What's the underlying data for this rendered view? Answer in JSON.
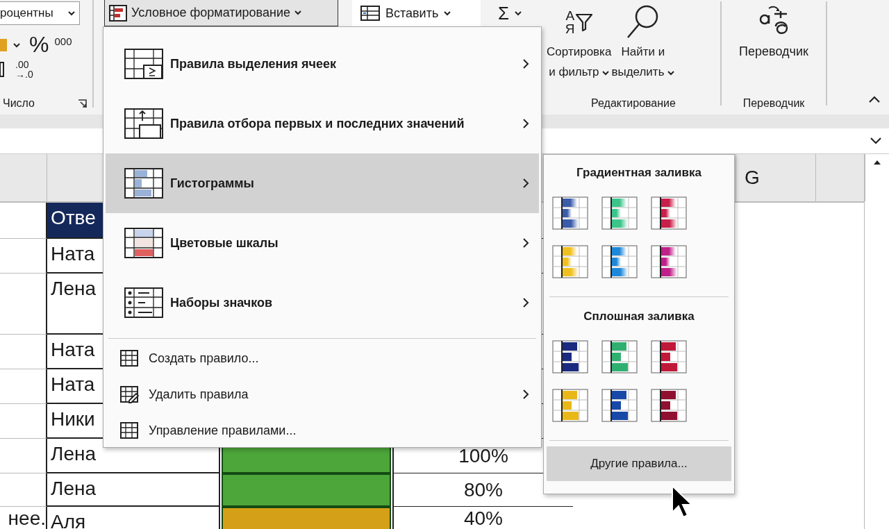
{
  "ribbon": {
    "number_format": {
      "value": "роцентны"
    },
    "percent_symbol": "%",
    "thousands_symbol": "000",
    "decimal_texts": [
      ".00",
      "→.0"
    ],
    "number_group_label": "Число",
    "conditional_formatting": {
      "label": "Условное форматирование",
      "expanded": true
    },
    "insert": {
      "label": "Вставить"
    },
    "sum_symbol": "Σ",
    "sort": {
      "icon_letters": [
        "А",
        "Я"
      ],
      "lines": [
        "Сортировка",
        "и фильтр"
      ]
    },
    "find": {
      "lines": [
        "Найти и",
        "выделить"
      ]
    },
    "editing_group_label": "Редактирование",
    "translator": {
      "label": "Переводчик"
    },
    "translator_group_label": "Переводчик"
  },
  "menu": {
    "items": [
      {
        "kind": "large",
        "label": "Правила выделения ячеек",
        "submenu": true,
        "selected": false
      },
      {
        "kind": "large",
        "label": "Правила отбора первых и последних значений",
        "submenu": true,
        "selected": false
      },
      {
        "kind": "large",
        "label": "Гистограммы",
        "submenu": true,
        "selected": true
      },
      {
        "kind": "large",
        "label": "Цветовые шкалы",
        "submenu": true,
        "selected": false
      },
      {
        "kind": "large",
        "label": "Наборы значков",
        "submenu": true,
        "selected": false
      },
      {
        "kind": "small",
        "label": "Создать правило...",
        "submenu": false,
        "selected": false
      },
      {
        "kind": "small",
        "label": "Удалить правила",
        "submenu": true,
        "selected": false
      },
      {
        "kind": "small",
        "label": "Управление правилами...",
        "submenu": false,
        "selected": false
      }
    ]
  },
  "submenu": {
    "sections": [
      {
        "title": "Градиентная заливка",
        "kind": "gradient",
        "swatches": [
          {
            "color": "#3b5bab"
          },
          {
            "color": "#3cc48a"
          },
          {
            "color": "#c8204a"
          },
          {
            "color": "#f0c020"
          },
          {
            "color": "#1e88d8"
          },
          {
            "color": "#c0208a"
          }
        ]
      },
      {
        "title": "Сплошная заливка",
        "kind": "solid",
        "swatches": [
          {
            "color": "#1a2a80"
          },
          {
            "color": "#30b070"
          },
          {
            "color": "#c01838"
          },
          {
            "color": "#e8b818"
          },
          {
            "color": "#1848a8"
          },
          {
            "color": "#901030"
          }
        ]
      }
    ],
    "more": {
      "label": "Другие правила...",
      "selected": true
    }
  },
  "sheet": {
    "column_headers": [
      {
        "label": "G"
      }
    ],
    "rows": [
      {
        "kind": "header",
        "name": "Отве"
      },
      {
        "kind": "data",
        "name": "Ната"
      },
      {
        "kind": "data",
        "name": "Лена"
      },
      {
        "kind": "data",
        "name": "Ната"
      },
      {
        "kind": "data",
        "name": "Ната"
      },
      {
        "kind": "data",
        "name": "Ники"
      },
      {
        "kind": "data",
        "name": "Лена",
        "color": "#4ca63a",
        "percent": "100%"
      },
      {
        "kind": "data",
        "name": "Лена",
        "color": "#4ca63a",
        "percent": "80%"
      },
      {
        "kind": "data",
        "name": "Аля",
        "col_a": "нее.",
        "color": "#d4a017",
        "percent": "40%"
      }
    ]
  }
}
